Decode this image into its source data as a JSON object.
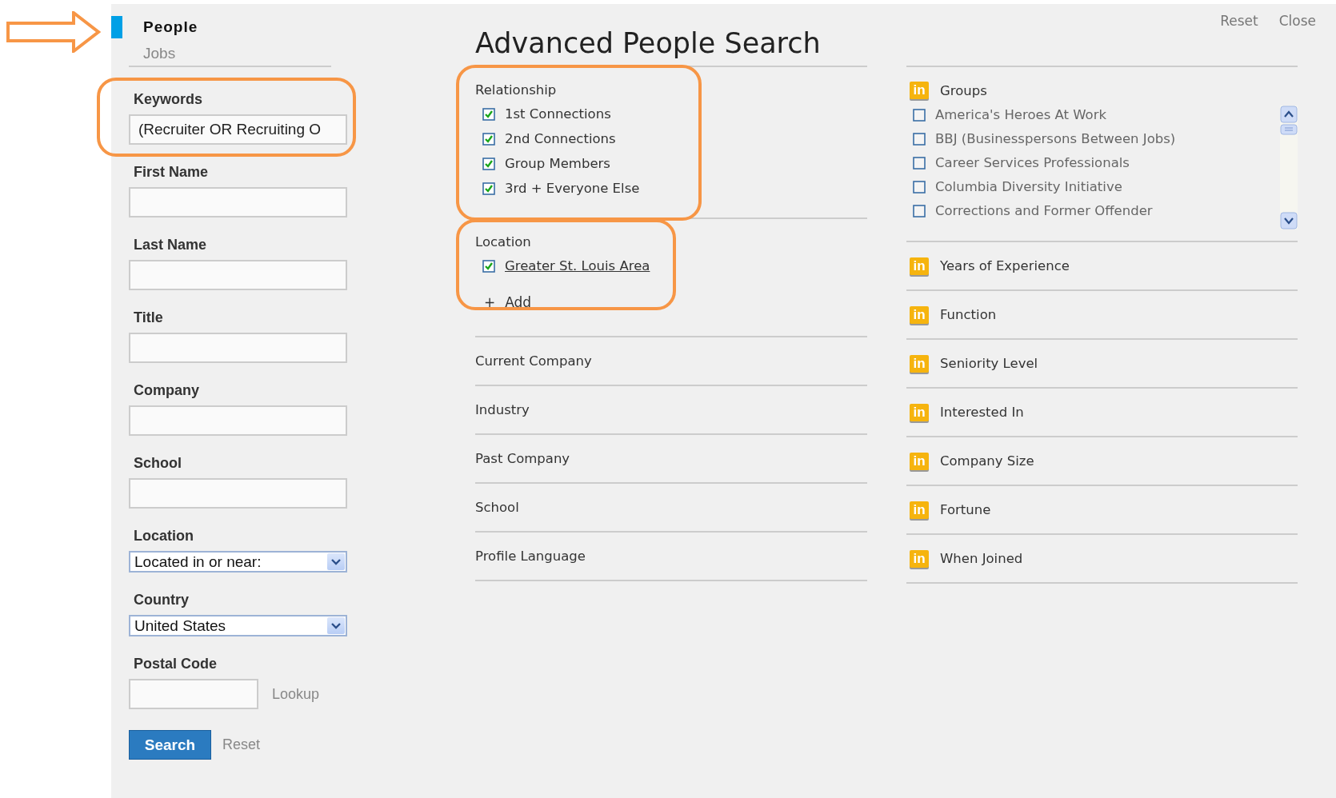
{
  "tabs": [
    {
      "label": "People",
      "selected": true
    },
    {
      "label": "Jobs",
      "selected": false
    }
  ],
  "form": {
    "fields": [
      {
        "kind": "text",
        "label": "Keywords",
        "value": "(Recruiter OR Recruiting O"
      },
      {
        "kind": "text",
        "label": "First Name"
      },
      {
        "kind": "text",
        "label": "Last Name"
      },
      {
        "kind": "text",
        "label": "Title"
      },
      {
        "kind": "text",
        "label": "Company"
      },
      {
        "kind": "text",
        "label": "School"
      },
      {
        "kind": "select",
        "label": "Location",
        "value": "Located in or near:"
      },
      {
        "kind": "select",
        "label": "Country",
        "value": "United States"
      },
      {
        "kind": "postal",
        "label": "Postal Code",
        "link": "Lookup"
      }
    ],
    "search_button": "Search",
    "reset_link": "Reset"
  },
  "header": {
    "title": "Advanced People Search",
    "links": [
      "Reset",
      "Close"
    ]
  },
  "facets_left": [
    {
      "kind": "checklist",
      "title": "Relationship",
      "options": [
        {
          "label": "1st Connections",
          "checked": true,
          "link": false
        },
        {
          "label": "2nd Connections",
          "checked": true,
          "link": false
        },
        {
          "label": "Group Members",
          "checked": true,
          "link": false
        },
        {
          "label": "3rd + Everyone Else",
          "checked": true,
          "link": false
        }
      ]
    },
    {
      "kind": "checklist",
      "title": "Location",
      "options": [
        {
          "label": "Greater St. Louis Area",
          "checked": true,
          "link": true
        }
      ],
      "add": {
        "icon": "+",
        "label": "Add"
      }
    },
    {
      "kind": "collapsed",
      "title": "Current Company"
    },
    {
      "kind": "collapsed",
      "title": "Industry"
    },
    {
      "kind": "collapsed",
      "title": "Past Company"
    },
    {
      "kind": "collapsed",
      "title": "School"
    },
    {
      "kind": "collapsed",
      "title": "Profile Language"
    }
  ],
  "facets_right": [
    {
      "kind": "scroll_list",
      "title": "Groups",
      "badge": "in",
      "options": [
        {
          "label": "America's Heroes At Work",
          "checked": false
        },
        {
          "label": "BBJ (Businesspersons Between Jobs)",
          "checked": false
        },
        {
          "label": "Career Services Professionals",
          "checked": false
        },
        {
          "label": "Columbia Diversity Initiative",
          "checked": false
        },
        {
          "label": "Corrections and Former Offender",
          "checked": false
        }
      ]
    },
    {
      "kind": "collapsed",
      "title": "Years of Experience",
      "badge": "in"
    },
    {
      "kind": "collapsed",
      "title": "Function",
      "badge": "in"
    },
    {
      "kind": "collapsed",
      "title": "Seniority Level",
      "badge": "in"
    },
    {
      "kind": "collapsed",
      "title": "Interested In",
      "badge": "in"
    },
    {
      "kind": "collapsed",
      "title": "Company Size",
      "badge": "in"
    },
    {
      "kind": "collapsed",
      "title": "Fortune",
      "badge": "in"
    },
    {
      "kind": "collapsed",
      "title": "When Joined",
      "badge": "in"
    }
  ]
}
